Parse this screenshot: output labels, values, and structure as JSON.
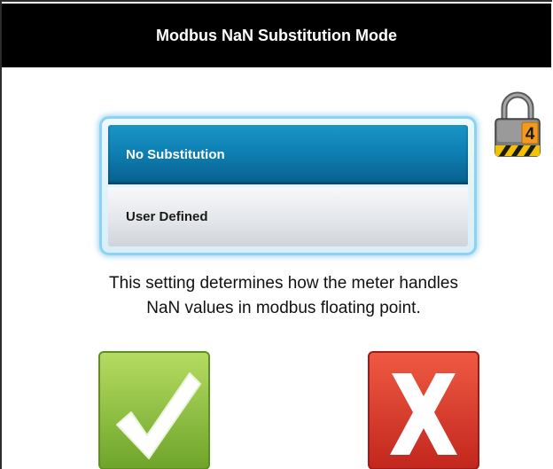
{
  "title": "Modbus NaN Substitution Mode",
  "options": [
    {
      "label": "No Substitution",
      "selected": true
    },
    {
      "label": "User Defined",
      "selected": false
    }
  ],
  "description_line1": "This setting determines how the meter handles",
  "description_line2": "NaN values in modbus floating point.",
  "lock_level": "4",
  "icons": {
    "lock": "padlock-icon",
    "ok": "checkmark-icon",
    "cancel": "x-icon"
  },
  "colors": {
    "title_bg": "#000000",
    "selected_option": "#0f80b3",
    "ok_button": "#8cc63f",
    "cancel_button": "#d93025"
  }
}
